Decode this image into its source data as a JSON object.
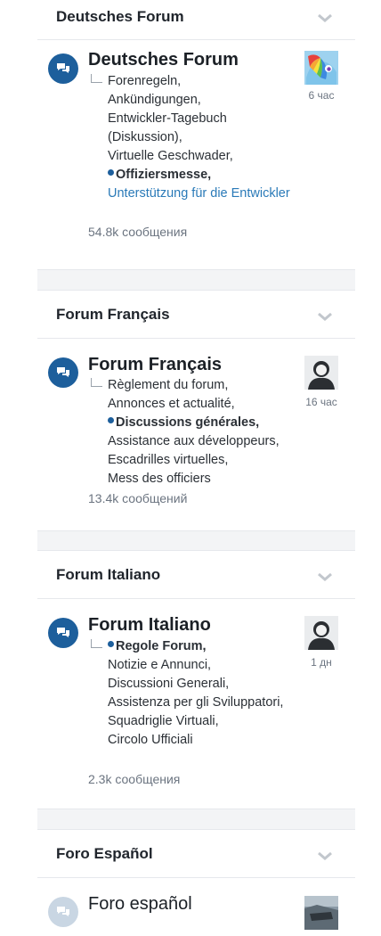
{
  "forums": [
    {
      "section_title": "Deutsches Forum",
      "node_title": "Deutsches Forum",
      "subforums": [
        "Forenregeln,",
        "Ankündigungen,",
        "Entwickler-Tagebuch (Diskussion),",
        "Virtuelle Geschwader,"
      ],
      "unread_sub": "Offiziersmesse,",
      "link_sub": "Unterstützung für die Entwickler",
      "count": "54.8k сообщения",
      "time": "6 час",
      "avatar": "rainbow-pony-avatar"
    },
    {
      "section_title": "Forum Français",
      "node_title": "Forum Français",
      "subforums_before": [
        "Règlement du forum,",
        "Annonces et actualité,"
      ],
      "unread_sub": "Discussions générales,",
      "subforums_after": [
        "Assistance aux développeurs,",
        "Escadrilles virtuelles,",
        "Mess des officiers"
      ],
      "count": "13.4k сообщений",
      "time": "16 час",
      "avatar": "default-user-avatar"
    },
    {
      "section_title": "Forum Italiano",
      "node_title": "Forum Italiano",
      "unread_sub": "Regole Forum,",
      "subforums_after": [
        "Notizie e Annunci,",
        "Discussioni Generali,",
        "Assistenza per gli Sviluppatori,",
        "Squadriglie Virtuali,",
        "Circolo Ufficiali"
      ],
      "count": "2.3k сообщения",
      "time": "1 дн",
      "avatar": "default-user-avatar"
    },
    {
      "section_title": "Foro Español",
      "node_title": "Foro español",
      "avatar": "photo-avatar"
    }
  ],
  "colors": {
    "accent": "#1d5f9c",
    "link": "#2a7ab8",
    "muted": "#6b7480",
    "gap": "#f3f4f6"
  },
  "icons": {
    "node": "comments-icon",
    "collapse": "chevron-down-icon"
  }
}
